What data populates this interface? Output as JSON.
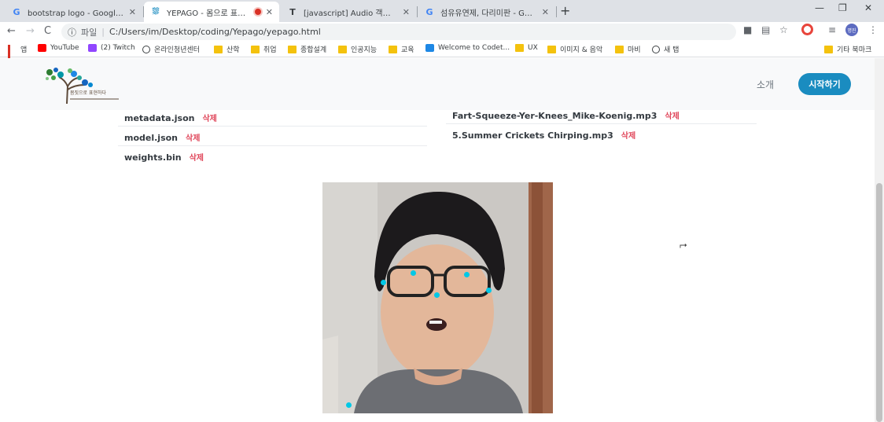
{
  "tabs": [
    {
      "favicon": "google-g-icon",
      "favicon_glyph": "G",
      "title": "bootstrap logo - Google 검색",
      "close": "✕"
    },
    {
      "favicon": "yepago-icon",
      "favicon_glyph": "⛆",
      "title": "YEPAGO - 몸으로 표현하는",
      "close": "✕"
    },
    {
      "favicon": "doc-icon",
      "favicon_glyph": "T",
      "title": "[javascript] Audio 객체를 이용한",
      "close": "✕"
    },
    {
      "favicon": "google-g-icon",
      "favicon_glyph": "G",
      "title": "섬유유연제, 다리미판 - Google",
      "close": "✕"
    }
  ],
  "new_tab": "+",
  "window_controls": {
    "minimize": "—",
    "restore": "❐",
    "close": "✕"
  },
  "toolbar": {
    "back": "←",
    "forward": "→",
    "reload": "C",
    "info": "ⓘ",
    "scheme": "파일",
    "url": "C:/Users/im/Desktop/coding/Yepago/yepago.html",
    "profile_initials": "명진"
  },
  "bookmarks": [
    {
      "icon": "apps",
      "label": "앱"
    },
    {
      "icon": "yt",
      "label": "YouTube"
    },
    {
      "icon": "twitch",
      "label": "(2) Twitch"
    },
    {
      "icon": "globe",
      "label": "온라인청년센터"
    },
    {
      "icon": "folder",
      "label": "산학"
    },
    {
      "icon": "folder",
      "label": "취업"
    },
    {
      "icon": "folder",
      "label": "종합설계"
    },
    {
      "icon": "folder",
      "label": "인공지능"
    },
    {
      "icon": "folder",
      "label": "교육"
    },
    {
      "icon": "codet",
      "label": "Welcome to Codet..."
    },
    {
      "icon": "folder",
      "label": "UX"
    },
    {
      "icon": "folder",
      "label": "이미지 & 음악"
    },
    {
      "icon": "folder",
      "label": "마비"
    },
    {
      "icon": "globe",
      "label": "새 탭"
    },
    {
      "icon": "folder",
      "label": "기타 북마크"
    }
  ],
  "navbar": {
    "intro": "소개",
    "start": "시작하기",
    "logo_text": "몸짓으로 표현하다"
  },
  "files_left": [
    {
      "name": "metadata.json",
      "action": "삭제"
    },
    {
      "name": "model.json",
      "action": "삭제"
    },
    {
      "name": "weights.bin",
      "action": "삭제"
    }
  ],
  "files_right": [
    {
      "name": "Fart-Squeeze-Yer-Knees_Mike-Koenig.mp3",
      "action": "삭제"
    },
    {
      "name": "5.Summer Crickets Chirping.mp3",
      "action": "삭제"
    }
  ],
  "colors": {
    "accent": "#1a8cc0",
    "delete": "#e0475b",
    "keypoint": "#00c8e6"
  }
}
